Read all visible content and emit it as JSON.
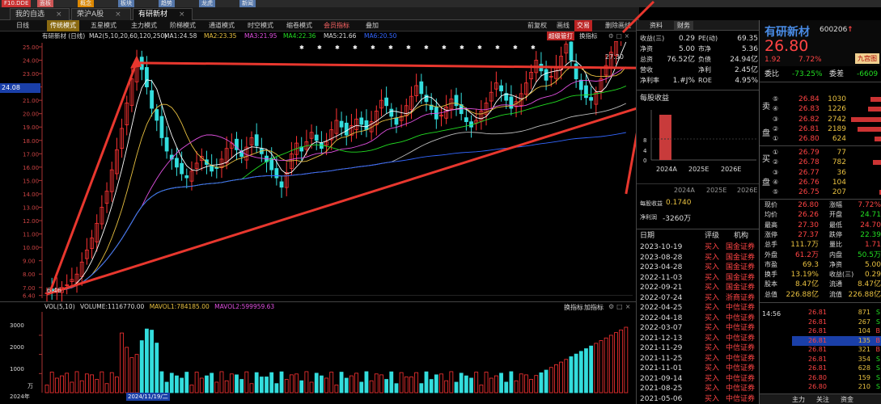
{
  "top_items": [
    "F10.DDE",
    "面板",
    "概念",
    "板块",
    "趋势",
    "龙虎",
    "新闻"
  ],
  "tabs": [
    "我的自选",
    "荣沪A股",
    "有研新材"
  ],
  "tabs_close": "×",
  "modes": [
    "日线",
    "传统模式",
    "五星模式",
    "主力模式",
    "阶梯模式",
    "通道模式",
    "时空模式",
    "缩卷模式",
    "会员指标",
    "叠加"
  ],
  "mode_right": [
    "前复权",
    "画线",
    "交易",
    "删除画线"
  ],
  "ma_line": {
    "name": "有研新材 (日线)",
    "ma2": "MA2(5,10,20,60,120,250)",
    "ma1": "MA1:24.58",
    "ma2v": "MA2:23.35",
    "ma3": "MA3:21.95",
    "ma4": "MA4:22.36",
    "ma5": "MA5:21.66",
    "ma6": "MA6:20.50"
  },
  "chart_buttons": {
    "btn1": "超级管打",
    "btn2": "换指标"
  },
  "price_ticks": [
    "25.00",
    "24.00",
    "23.00",
    "22.00",
    "21.00",
    "20.00",
    "19.00",
    "18.00",
    "17.00",
    "16.00",
    "15.00",
    "14.00",
    "13.00",
    "12.00",
    "11.00",
    "10.00",
    "9.00",
    "8.00",
    "7.00",
    "6.40"
  ],
  "price_label": "24.08",
  "high_label": "27.30",
  "low_label": "6.46",
  "vol_line": {
    "vol": "VOL(5,10)",
    "volume": "VOLUME:1116770.00",
    "mavol1": "MAVOL1:784185.00",
    "mavol2": "MAVOL2:599959.63"
  },
  "vol_buttons": {
    "b1": "换指标",
    "b2": "加指标"
  },
  "vol_ticks": [
    "3000",
    "2000",
    "1000"
  ],
  "vol_unit": "万",
  "date_left": "2024年",
  "date_highlight": "2024/11/19/二",
  "right_tabs": [
    "资料",
    "财务"
  ],
  "fin_rows": [
    {
      "l": "收益(三)",
      "v": "0.29",
      "l2": "PE(动)",
      "v2": "69.35"
    },
    {
      "l": "净资",
      "v": "5.00",
      "l2": "市净",
      "v2": "5.36"
    },
    {
      "l": "总资",
      "v": "76.52亿",
      "l2": "负债",
      "v2": "24.94亿"
    },
    {
      "l": "营收",
      "v": "",
      "l2": "净利",
      "v2": "2.45亿"
    },
    {
      "l": "净利率",
      "v": "1.#J%",
      "l2": "ROE",
      "v2": "4.95%"
    }
  ],
  "eps_title": "每股收益",
  "eps_years": [
    "2024A",
    "2025E",
    "2026E"
  ],
  "eps_ticks": [
    "8",
    "4",
    "0"
  ],
  "eps_years2": [
    "2024A",
    "2025E",
    "2026E"
  ],
  "eps_label": "每股收益",
  "eps_value": "0.1740",
  "np_label": "净利润",
  "np_value": "-3260万",
  "rating_header": {
    "date": "日期",
    "rating": "评级",
    "org": "机构"
  },
  "ratings": [
    {
      "date": "2023-10-19",
      "rating": "买入",
      "org": "国金证券"
    },
    {
      "date": "2023-08-28",
      "rating": "买入",
      "org": "国金证券"
    },
    {
      "date": "2023-04-28",
      "rating": "买入",
      "org": "国金证券"
    },
    {
      "date": "2022-11-03",
      "rating": "买入",
      "org": "国金证券"
    },
    {
      "date": "2022-09-21",
      "rating": "买入",
      "org": "国金证券"
    },
    {
      "date": "2022-07-24",
      "rating": "买入",
      "org": "浙商证券"
    },
    {
      "date": "2022-04-25",
      "rating": "买入",
      "org": "中信证券"
    },
    {
      "date": "2022-04-18",
      "rating": "买入",
      "org": "中信证券"
    },
    {
      "date": "2022-03-07",
      "rating": "买入",
      "org": "中信证券"
    },
    {
      "date": "2021-12-13",
      "rating": "买入",
      "org": "中信证券"
    },
    {
      "date": "2021-11-29",
      "rating": "买入",
      "org": "中信证券"
    },
    {
      "date": "2021-11-25",
      "rating": "买入",
      "org": "中信证券"
    },
    {
      "date": "2021-11-01",
      "rating": "买入",
      "org": "中信证券"
    },
    {
      "date": "2021-09-14",
      "rating": "买入",
      "org": "中信证券"
    },
    {
      "date": "2021-08-25",
      "rating": "买入",
      "org": "中信证券"
    },
    {
      "date": "2021-05-06",
      "rating": "买入",
      "org": "中信证券"
    }
  ],
  "stock": {
    "name": "有研新材",
    "code": "600206",
    "price": "26.80",
    "change": "1.92",
    "pct": "7.72%",
    "tag": "九宫图",
    "badge": "↑"
  },
  "weibi": {
    "l": "委比",
    "v": "-73.25%",
    "l2": "委差",
    "v2": "-6609"
  },
  "sell": [
    {
      "l": "⑤",
      "p": "26.84",
      "v": "1030"
    },
    {
      "l": "④",
      "p": "26.83",
      "v": "1226"
    },
    {
      "l": "③",
      "p": "26.82",
      "v": "2742"
    },
    {
      "l": "②",
      "p": "26.81",
      "v": "2189"
    },
    {
      "l": "①",
      "p": "26.80",
      "v": "624"
    }
  ],
  "sell_side": [
    "卖",
    "盘"
  ],
  "buy": [
    {
      "l": "①",
      "p": "26.79",
      "v": "77"
    },
    {
      "l": "②",
      "p": "26.78",
      "v": "782"
    },
    {
      "l": "③",
      "p": "26.77",
      "v": "36"
    },
    {
      "l": "④",
      "p": "26.76",
      "v": "104"
    },
    {
      "l": "⑤",
      "p": "26.75",
      "v": "207"
    }
  ],
  "buy_side": [
    "买",
    "盘"
  ],
  "quote": [
    {
      "l": "现价",
      "v": "26.80",
      "l2": "涨幅",
      "v2": "7.72%"
    },
    {
      "l": "均价",
      "v": "26.26",
      "l2": "开盘",
      "v2": "24.71"
    },
    {
      "l": "最高",
      "v": "27.30",
      "l2": "最低",
      "v2": "24.70"
    },
    {
      "l": "涨停",
      "v": "27.37",
      "l2": "跌停",
      "v2": "22.39"
    },
    {
      "l": "总手",
      "v": "111.7万",
      "l2": "量比",
      "v2": "1.71"
    },
    {
      "l": "外盘",
      "v": "61.2万",
      "l2": "内盘",
      "v2": "50.5万"
    },
    {
      "l": "市盈",
      "v": "69.3",
      "l2": "净资",
      "v2": "5.00"
    },
    {
      "l": "换手",
      "v": "13.19%",
      "l2": "收益(三)",
      "v2": "0.29"
    },
    {
      "l": "股本",
      "v": "8.47亿",
      "l2": "流通",
      "v2": "8.47亿"
    },
    {
      "l": "总值",
      "v": "226.88亿",
      "l2": "流值",
      "v2": "226.88亿"
    }
  ],
  "ticks_time": "14:56",
  "ticks": [
    {
      "p": "26.81",
      "v": "871",
      "s": "S"
    },
    {
      "p": "26.81",
      "v": "267",
      "s": "S"
    },
    {
      "p": "26.81",
      "v": "104",
      "s": "B"
    },
    {
      "p": "26.81",
      "v": "135",
      "s": "B"
    },
    {
      "p": "26.81",
      "v": "321",
      "s": "B"
    },
    {
      "p": "26.81",
      "v": "354",
      "s": "S"
    },
    {
      "p": "26.81",
      "v": "628",
      "s": "S"
    },
    {
      "p": "26.80",
      "v": "159",
      "s": "S"
    },
    {
      "p": "26.80",
      "v": "210",
      "s": "S"
    }
  ],
  "bottom_tabs": [
    "主力",
    "关注",
    "资金"
  ],
  "candles": [
    6.6,
    6.7,
    6.9,
    7.0,
    7.2,
    7.6,
    8.0,
    8.9,
    9.8,
    10.7,
    11.8,
    13.0,
    14.2,
    15.8,
    17.3,
    18.9,
    20.8,
    22.6,
    24.0,
    23.3,
    22.0,
    20.4,
    19.5,
    18.2,
    17.2,
    16.6,
    16.0,
    15.5,
    15.2,
    15.7,
    16.3,
    16.8,
    16.2,
    15.7,
    15.9,
    16.6,
    17.4,
    17.8,
    17.3,
    16.8,
    17.5,
    18.2,
    17.6,
    17.0,
    16.4,
    15.8,
    15.2,
    14.5,
    15.6,
    17.0,
    17.8,
    17.2,
    17.9,
    18.6,
    18.0,
    17.4,
    17.9,
    18.8,
    19.5,
    19.0,
    18.4,
    19.1,
    19.6,
    19.2,
    18.8,
    19.4,
    20.2,
    21.0,
    20.6,
    19.8,
    19.2,
    19.8,
    20.6,
    21.3,
    22.1,
    21.5,
    20.9,
    20.3,
    19.6,
    19.9,
    20.5,
    21.1,
    20.6,
    20.0,
    19.4,
    19.0,
    19.5,
    20.2,
    20.8,
    21.6,
    22.3,
    21.7,
    21.0,
    20.4,
    20.9,
    21.5,
    22.3,
    23.1,
    24.0,
    23.2,
    22.5,
    22.8,
    23.5,
    24.3,
    25.2,
    24.0,
    22.6,
    21.8,
    21.2,
    21.0,
    21.6,
    22.6,
    23.6,
    24.6,
    25.4,
    26.2,
    27.0
  ]
}
